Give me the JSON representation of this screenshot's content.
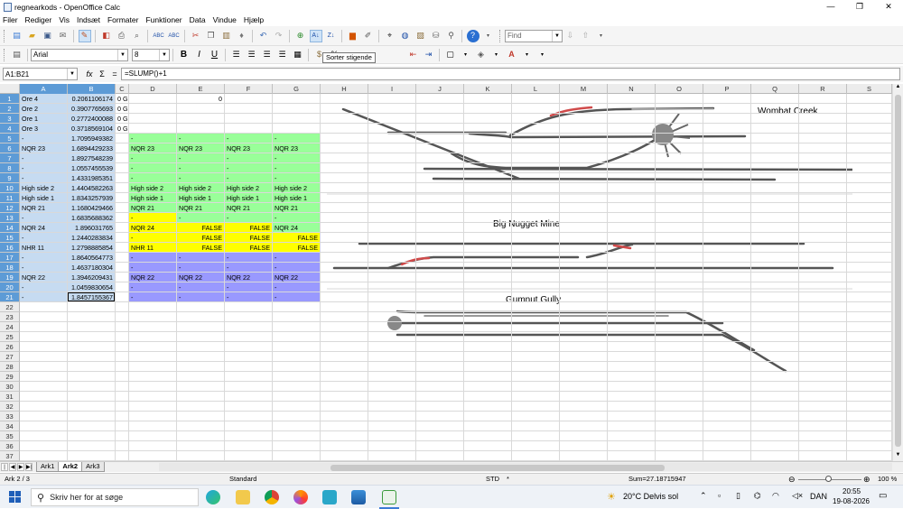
{
  "window": {
    "title": "regnearkods - OpenOffice Calc",
    "minimize": "—",
    "maximize": "❐",
    "close": "✕"
  },
  "menu": [
    "Filer",
    "Rediger",
    "Vis",
    "Indsæt",
    "Formater",
    "Funktioner",
    "Data",
    "Vindue",
    "Hjælp"
  ],
  "toolbar": {
    "find_placeholder": "Find",
    "tooltip": "Sorter stigende"
  },
  "format": {
    "font_name": "Arial",
    "font_size": "8",
    "bold": "B",
    "italic": "I",
    "underline": "U"
  },
  "formula": {
    "namebox": "A1:B21",
    "fx": "fx",
    "sum": "Σ",
    "eq": "=",
    "content": "=SLUMP()+1"
  },
  "columns": [
    "A",
    "B",
    "C",
    "D",
    "E",
    "F",
    "G",
    "H",
    "I",
    "J",
    "K",
    "L",
    "M",
    "N",
    "O",
    "P",
    "Q",
    "R",
    "S"
  ],
  "rows": [
    "1",
    "2",
    "3",
    "4",
    "5",
    "6",
    "7",
    "8",
    "9",
    "10",
    "11",
    "12",
    "13",
    "14",
    "15",
    "16",
    "17",
    "18",
    "19",
    "20",
    "21",
    "22",
    "23",
    "24",
    "25",
    "26",
    "27",
    "28",
    "29",
    "30",
    "31",
    "32",
    "33",
    "34",
    "35",
    "36",
    "37"
  ],
  "colA": [
    "Ore 4",
    "Ore 2",
    "Ore 1",
    "Ore 3",
    "-",
    "NQR 23",
    "-",
    "-",
    "-",
    "High side 2",
    "High side 1",
    "NQR 21",
    "-",
    "NQR 24",
    "-",
    "NHR 11",
    "-",
    "-",
    "NQR 22",
    "-",
    "-"
  ],
  "colB": [
    "0.2061106174",
    "0.3907765693",
    "0.2772400088",
    "0.3718569104",
    "1.7095949382",
    "1.6894429233",
    "1.8927548239",
    "1.0557455539",
    "1.4331985351",
    "1.4404582263",
    "1.8343257939",
    "1.1680429466",
    "1.6835688362",
    "1.896031765",
    "1.2440283834",
    "1.2798885854",
    "1.8640564773",
    "1.4637180304",
    "1.3946209431",
    "1.0459830654",
    "1.8457155367"
  ],
  "colC": [
    "0 GG",
    "0 GG",
    "0 GG",
    "0 GG"
  ],
  "e1": "0",
  "groups": {
    "g5": "-",
    "g6": "NQR 23",
    "g10": "High side 2",
    "g11": "High side 1",
    "g12": "NQR 21",
    "g13": "-",
    "g14": "NQR 24",
    "g15": "-",
    "g16": "NHR 11",
    "g19": "NQR 22",
    "false": "FALSE"
  },
  "diagrams": {
    "wombat": "Wombat Creek",
    "nugget": "Big Nugget Mine",
    "gumnut": "Gumnut Gully"
  },
  "sheets": [
    "Ark1",
    "Ark2",
    "Ark3"
  ],
  "status": {
    "sheet": "Ark 2 / 3",
    "style": "Standard",
    "mode": "STD",
    "star": "*",
    "sum": "Sum=27.18715947",
    "zoom": "100 %"
  },
  "taskbar": {
    "search": "Skriv her for at søge",
    "weather": "20°C  Delvis sol",
    "lang": "DAN",
    "time": "20:55",
    "date": "19-08-2026"
  },
  "colors": {
    "green": "#99ff99",
    "yellow": "#ffff00",
    "purple": "#9999ff",
    "selection": "#c6dbf1",
    "header_selected": "#5d9bd6"
  }
}
